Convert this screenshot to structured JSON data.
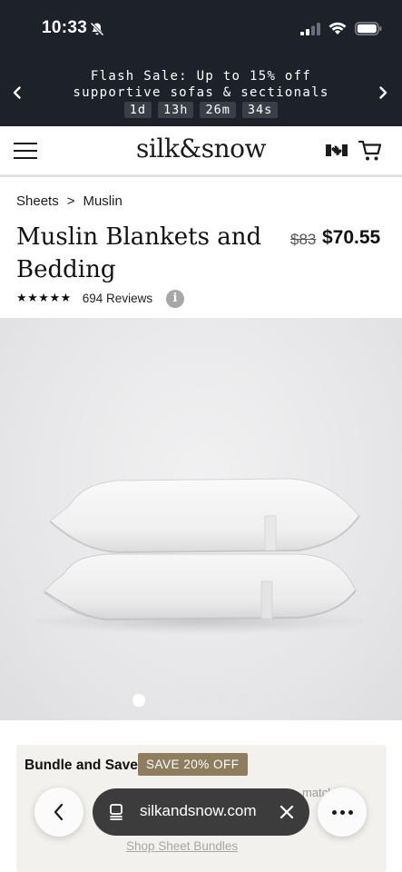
{
  "status_bar": {
    "time": "10:33"
  },
  "promo": {
    "text": "Flash Sale: Up to 15% off supportive sofas & sectionals",
    "countdown": [
      "1d",
      "13h",
      "26m",
      "34s"
    ]
  },
  "header": {
    "logo": "silk&snow"
  },
  "breadcrumb": {
    "parent": "Sheets",
    "separator": ">",
    "current": "Muslin"
  },
  "product": {
    "title": "Muslin Blankets and Bedding",
    "original_price": "$83",
    "sale_price": "$70.55",
    "stars": "★★★★★",
    "rating": 5,
    "reviews": "694 Reviews",
    "info_glyph": "i"
  },
  "carousel": {
    "total": 7,
    "active_index": 0
  },
  "bundle": {
    "title": "Bundle and Save",
    "badge": "SAVE 20% OFF",
    "partial_text": "matchi",
    "link": "Shop Sheet Bundles"
  },
  "browser": {
    "url": "silkandsnow.com"
  },
  "colors": {
    "promo_bg": "#1d222a",
    "badge_bg": "#8e7d5f",
    "url_pill_bg": "#3c3c3d"
  }
}
